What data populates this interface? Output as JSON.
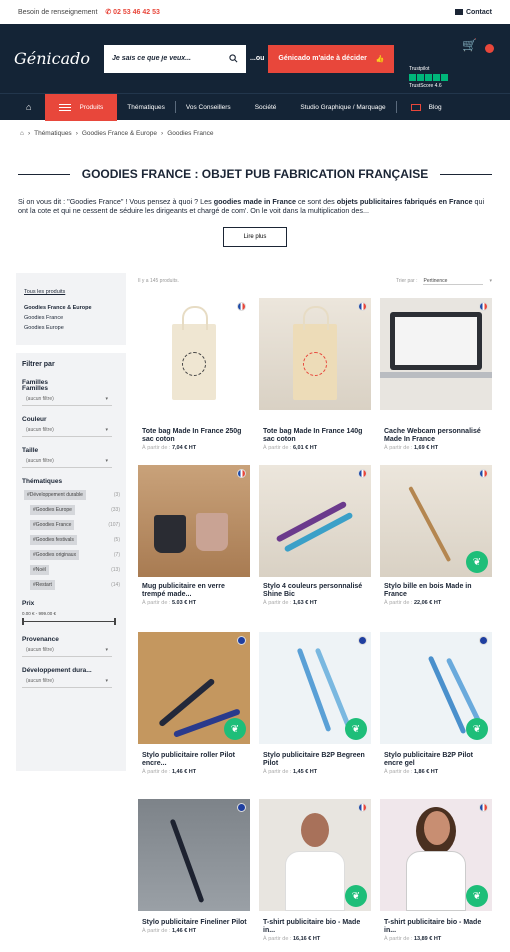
{
  "topbar": {
    "help_text": "Besoin de renseignement",
    "phone": "02 53 46 42 53",
    "contact_label": "Contact"
  },
  "header": {
    "logo": "Génicado",
    "search_placeholder": "Je sais ce que je veux...",
    "or_label": "...ou",
    "cta_label": "Génicado m'aide à décider",
    "trust_label": "Trustpilot",
    "trust_score": "TrustScore 4.6",
    "cart_count": ""
  },
  "nav": {
    "items": [
      "Produits",
      "Thématiques",
      "Vos Conseillers",
      "Société",
      "Studio Graphique / Marquage",
      "Blog"
    ]
  },
  "breadcrumb": [
    "Thématiques",
    "Goodies France & Europe",
    "Goodies France"
  ],
  "page": {
    "title": "GOODIES FRANCE : OBJET PUB FABRICATION FRANÇAISE",
    "intro_1": "Si on vous dit : \"Goodies France\" ! Vous pensez à quoi ? Les ",
    "intro_b1": "goodies made in France",
    "intro_2": " ce sont des ",
    "intro_b2": "objets publicitaires fabriqués en France",
    "intro_3": " qui ont la cote et qui ne cessent de séduire les dirigeants et chargé de com'. On le voit dans la multiplication des...",
    "more_label": "Lire plus"
  },
  "sidebar": {
    "all_products": "Tous les produits",
    "current": "Goodies France & Europe",
    "sub": [
      "Goodies France",
      "Goodies Europe"
    ],
    "filter_title": "Filtrer par",
    "filters": [
      {
        "label": "Familles Familles",
        "value": "(aucun filtre)"
      },
      {
        "label": "Couleur",
        "value": "(aucun filtre)"
      },
      {
        "label": "Taille",
        "value": "(aucun filtre)"
      }
    ],
    "themes_label": "Thématiques",
    "tags": [
      {
        "name": "#Développement durable",
        "count": "(3)"
      },
      {
        "name": "#Goodies Europe",
        "count": "(33)"
      },
      {
        "name": "#Goodies France",
        "count": "(107)"
      },
      {
        "name": "#Goodies festivals",
        "count": "(5)"
      },
      {
        "name": "#Goodies originaux",
        "count": "(7)"
      },
      {
        "name": "#Noël",
        "count": "(13)"
      },
      {
        "name": "#Restart",
        "count": "(14)"
      }
    ],
    "price_label": "Prix",
    "price_range": "0.00 € - 999.00 €",
    "provenance_label": "Provenance",
    "provenance_value": "(aucun filtre)",
    "dev_label": "Développement dura...",
    "dev_value": "(aucun filtre)"
  },
  "listing": {
    "count_text": "Il y a 145 produits.",
    "sort_label": "Trier par :",
    "sort_value": "Pertinence",
    "price_prefix": "À partir de :",
    "products": [
      {
        "name": "Tote bag Made In France 250g sac coton",
        "price": "7,04 € HT"
      },
      {
        "name": "Tote bag Made In France 140g sac coton",
        "price": "6,01 € HT"
      },
      {
        "name": "Cache Webcam personnalisé Made In France",
        "price": "1,69 € HT"
      },
      {
        "name": "Mug publicitaire en verre trempé made...",
        "price": "5.03 € HT"
      },
      {
        "name": "Stylo 4 couleurs personnalisé Shine Bic",
        "price": "1,63 € HT"
      },
      {
        "name": "Stylo bille en bois Made in France",
        "price": "22,06 € HT"
      },
      {
        "name": "Stylo publicitaire roller Pilot encre...",
        "price": "1,46 € HT"
      },
      {
        "name": "Stylo publicitaire B2P Begreen Pilot",
        "price": "1,45 € HT"
      },
      {
        "name": "Stylo publicitaire B2P Pilot encre gel",
        "price": "1,86 € HT"
      },
      {
        "name": "Stylo publicitaire Fineliner Pilot",
        "price": "1,46 € HT"
      },
      {
        "name": "T-shirt publicitaire bio - Made in...",
        "price": "16,16 € HT"
      },
      {
        "name": "T-shirt publicitaire bio - Made in...",
        "price": "13,89 € HT"
      }
    ]
  },
  "colors": {
    "navy": "#142436",
    "accent": "#e8473b",
    "eco": "#1ebe79"
  }
}
